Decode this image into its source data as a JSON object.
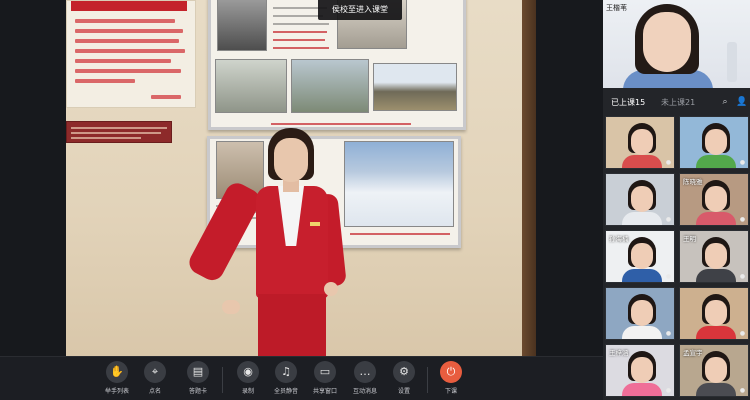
{
  "toast": "侯校至进入课堂",
  "toolbar": {
    "items": [
      {
        "label": "举手列表",
        "icon": "hand-icon"
      },
      {
        "label": "点名",
        "icon": "location-pin-icon"
      },
      {
        "label": "答题卡",
        "icon": "answer-card-icon"
      },
      {
        "label": "录制",
        "icon": "record-icon"
      },
      {
        "label": "全员静音",
        "icon": "mute-all-icon"
      },
      {
        "label": "共享窗口",
        "icon": "share-screen-icon"
      },
      {
        "label": "互动消息",
        "icon": "chat-icon"
      },
      {
        "label": "设置",
        "icon": "gear-icon"
      },
      {
        "label": "下课",
        "icon": "power-icon"
      }
    ]
  },
  "sidebar": {
    "teacher_name": "王楷苇",
    "tabs": {
      "attended": "已上课15",
      "absent": "未上课21"
    },
    "students": [
      {
        "name": "",
        "bg": "#d9c4a7",
        "shirt": "#d94d4d"
      },
      {
        "name": "",
        "bg": "#93b8d8",
        "shirt": "#53a84b"
      },
      {
        "name": "",
        "bg": "#c9cfd6",
        "shirt": "#e7eaee"
      },
      {
        "name": "陈晓雅",
        "bg": "#b79a82",
        "shirt": "#d85a6a"
      },
      {
        "name": "孙海楠",
        "bg": "#eef0f2",
        "shirt": "#2f5fa8"
      },
      {
        "name": "王明",
        "bg": "#c7c2bd",
        "shirt": "#3f4147"
      },
      {
        "name": "",
        "bg": "#8ea7c2",
        "shirt": "#f2f2f2"
      },
      {
        "name": "",
        "bg": "#cdb08f",
        "shirt": "#d9353b"
      },
      {
        "name": "王梓涵",
        "bg": "#dcdbe1",
        "shirt": "#ef6e98"
      },
      {
        "name": "孟宣宇",
        "bg": "#b8a78f",
        "shirt": "#4b4c52"
      }
    ]
  }
}
